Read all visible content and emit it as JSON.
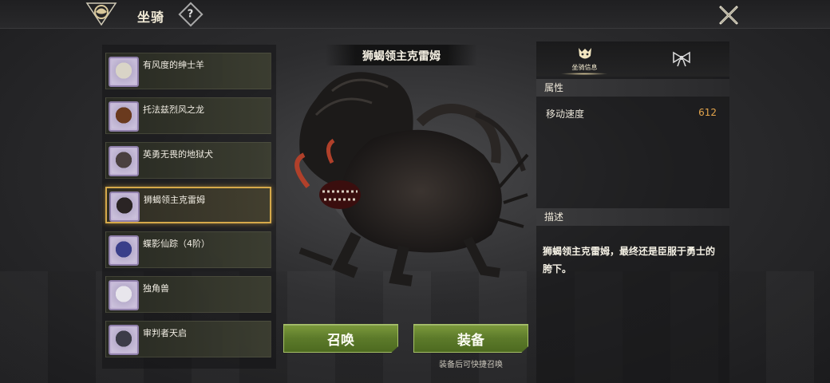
{
  "header": {
    "title": "坐骑",
    "help_label": "?"
  },
  "mounts": [
    {
      "name": "有风度的绅士羊",
      "color": "#d9d4c7",
      "selected": false
    },
    {
      "name": "托法兹烈风之龙",
      "color": "#6a3a1e",
      "selected": false
    },
    {
      "name": "英勇无畏的地狱犬",
      "color": "#4a4040",
      "selected": false
    },
    {
      "name": "狮蝎领主克雷姆",
      "color": "#2a2424",
      "selected": true
    },
    {
      "name": "蝶影仙踪（4阶）",
      "color": "#3a3f8a",
      "selected": false
    },
    {
      "name": "独角兽",
      "color": "#e8e6ec",
      "selected": false
    },
    {
      "name": "审判者天启",
      "color": "#3c3c48",
      "selected": false
    }
  ],
  "detail": {
    "mount_name": "狮蝎领主克雷姆",
    "summon_label": "召唤",
    "equip_label": "装备",
    "equip_hint": "装备后可快捷召唤"
  },
  "info_panel": {
    "tab_mount_info_label": "坐骑信息",
    "attributes_header": "属性",
    "attribute_name": "移动速度",
    "attribute_value": "612",
    "description_header": "描述",
    "description": "狮蝎领主克雷姆，最终还是臣服于勇士的胯下。"
  },
  "colors": {
    "accent_gold": "#d6a94a",
    "button_green": "#5c7a2a",
    "value_orange": "#e4a54c"
  }
}
